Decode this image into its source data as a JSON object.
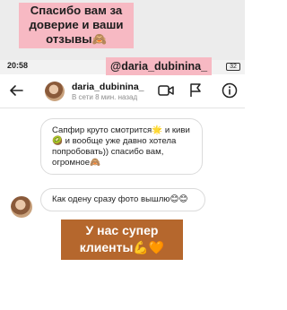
{
  "overlay": {
    "top_caption": "Спасибо вам за доверие и ваши отзывы🙈",
    "handle": "@daria_dubinina_",
    "bottom_caption": "У нас супер клиенты💪🧡"
  },
  "status_bar": {
    "time": "20:58",
    "battery": "32"
  },
  "header": {
    "username": "daria_dubinina_",
    "last_seen": "В сети 8 мин. назад",
    "icons": [
      "back-arrow-icon",
      "video-call-icon",
      "flag-icon",
      "info-icon"
    ]
  },
  "messages": [
    {
      "text": "Сапфир круто смотрится🌟 и киви 🥝 и вообще уже давно хотела попробовать)) спасибо вам, огромное🙈"
    },
    {
      "text": "Как одену сразу фото вышлю😊😊"
    }
  ],
  "colors": {
    "pink_caption": "#f7b9c3",
    "brown_caption": "#b5672d",
    "bubble_border": "#dbdbdb"
  }
}
